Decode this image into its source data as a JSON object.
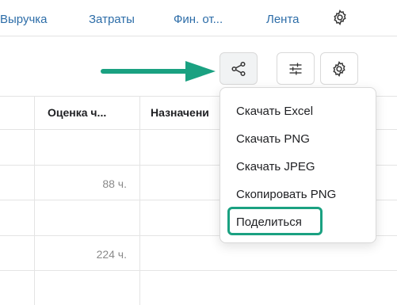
{
  "nav": {
    "tabs": [
      {
        "label": "Выручка"
      },
      {
        "label": "Затраты"
      },
      {
        "label": "Фин. от..."
      },
      {
        "label": "Лента"
      }
    ],
    "settings_icon": "gear-icon"
  },
  "toolbar": {
    "share_icon": "share-icon",
    "filter_icon": "sliders-icon",
    "settings_icon": "gear-icon",
    "annotation_arrow_color": "#1aa181"
  },
  "table": {
    "headers": [
      "Оценка ч...",
      "Назначени"
    ],
    "rows": [
      {
        "estimate": ""
      },
      {
        "estimate": "88 ч."
      },
      {
        "estimate": ""
      },
      {
        "estimate": "224 ч."
      },
      {
        "estimate": ""
      }
    ]
  },
  "share_menu": {
    "items": [
      {
        "label": "Скачать Excel"
      },
      {
        "label": "Скачать PNG"
      },
      {
        "label": "Скачать JPEG"
      },
      {
        "label": "Скопировать PNG"
      },
      {
        "label": "Поделиться"
      }
    ],
    "highlight_color": "#1aa181"
  }
}
